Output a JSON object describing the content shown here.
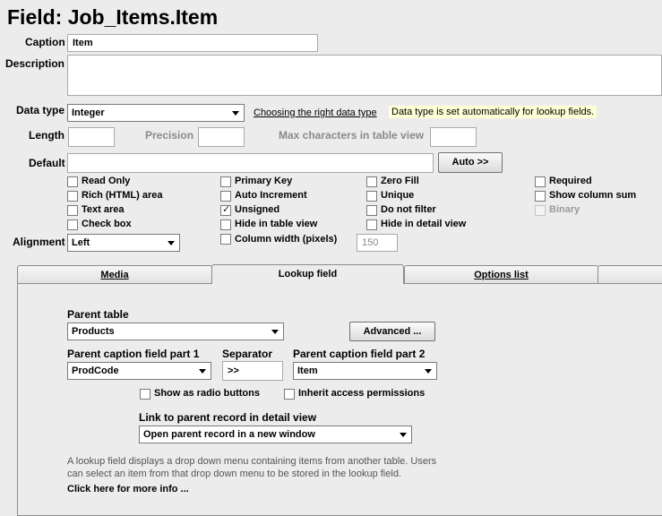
{
  "title": "Field: Job_Items.Item",
  "caption": {
    "label": "Caption",
    "value": "Item"
  },
  "description": {
    "label": "Description",
    "value": ""
  },
  "data_type": {
    "label": "Data type",
    "value": "Integer",
    "help_link": "Choosing the right data type",
    "note": "Data type is set automatically for lookup fields."
  },
  "length": {
    "label": "Length",
    "value": ""
  },
  "precision": {
    "label": "Precision",
    "value": ""
  },
  "max_chars": {
    "label": "Max characters in table view",
    "value": ""
  },
  "default": {
    "label": "Default",
    "value": "",
    "auto_button": "Auto >>"
  },
  "checkboxes": {
    "read_only": {
      "label": "Read Only",
      "checked": false
    },
    "rich_html": {
      "label": "Rich (HTML) area",
      "checked": false
    },
    "text_area": {
      "label": "Text area",
      "checked": false
    },
    "check_box": {
      "label": "Check box",
      "checked": false
    },
    "primary_key": {
      "label": "Primary Key",
      "checked": false
    },
    "auto_increment": {
      "label": "Auto Increment",
      "checked": false
    },
    "unsigned": {
      "label": "Unsigned",
      "checked": true
    },
    "hide_table_view": {
      "label": "Hide in table view",
      "checked": false
    },
    "column_width": {
      "label": "Column width (pixels)",
      "checked": false
    },
    "zero_fill": {
      "label": "Zero Fill",
      "checked": false
    },
    "unique": {
      "label": "Unique",
      "checked": false
    },
    "do_not_filter": {
      "label": "Do not filter",
      "checked": false
    },
    "hide_detail_view": {
      "label": "Hide in detail view",
      "checked": false
    },
    "required": {
      "label": "Required",
      "checked": false
    },
    "show_column_sum": {
      "label": "Show column sum",
      "checked": false
    },
    "binary": {
      "label": "Binary",
      "checked": false,
      "disabled": true
    }
  },
  "column_width_value": "150",
  "alignment": {
    "label": "Alignment",
    "value": "Left"
  },
  "tabs": [
    {
      "label": "Media",
      "active": false
    },
    {
      "label": "Lookup field",
      "active": true
    },
    {
      "label": "Options list",
      "active": false
    }
  ],
  "lookup": {
    "parent_table": {
      "label": "Parent table",
      "value": "Products"
    },
    "advanced_button": "Advanced ...",
    "caption_part1": {
      "label": "Parent caption field part 1",
      "value": "ProdCode"
    },
    "separator": {
      "label": "Separator",
      "value": ">>"
    },
    "caption_part2": {
      "label": "Parent caption field part 2",
      "value": "Item"
    },
    "show_radio": {
      "label": "Show as radio buttons",
      "checked": false
    },
    "inherit_permissions": {
      "label": "Inherit access permissions",
      "checked": false
    },
    "link_parent": {
      "label": "Link to parent record in detail view",
      "value": "Open parent record in a new window"
    },
    "info_line1": "A lookup field displays a drop down menu containing items from another table. Users",
    "info_line2": "can select an item from that drop down menu to be stored in the lookup field.",
    "more_info": "Click here for more info ..."
  }
}
